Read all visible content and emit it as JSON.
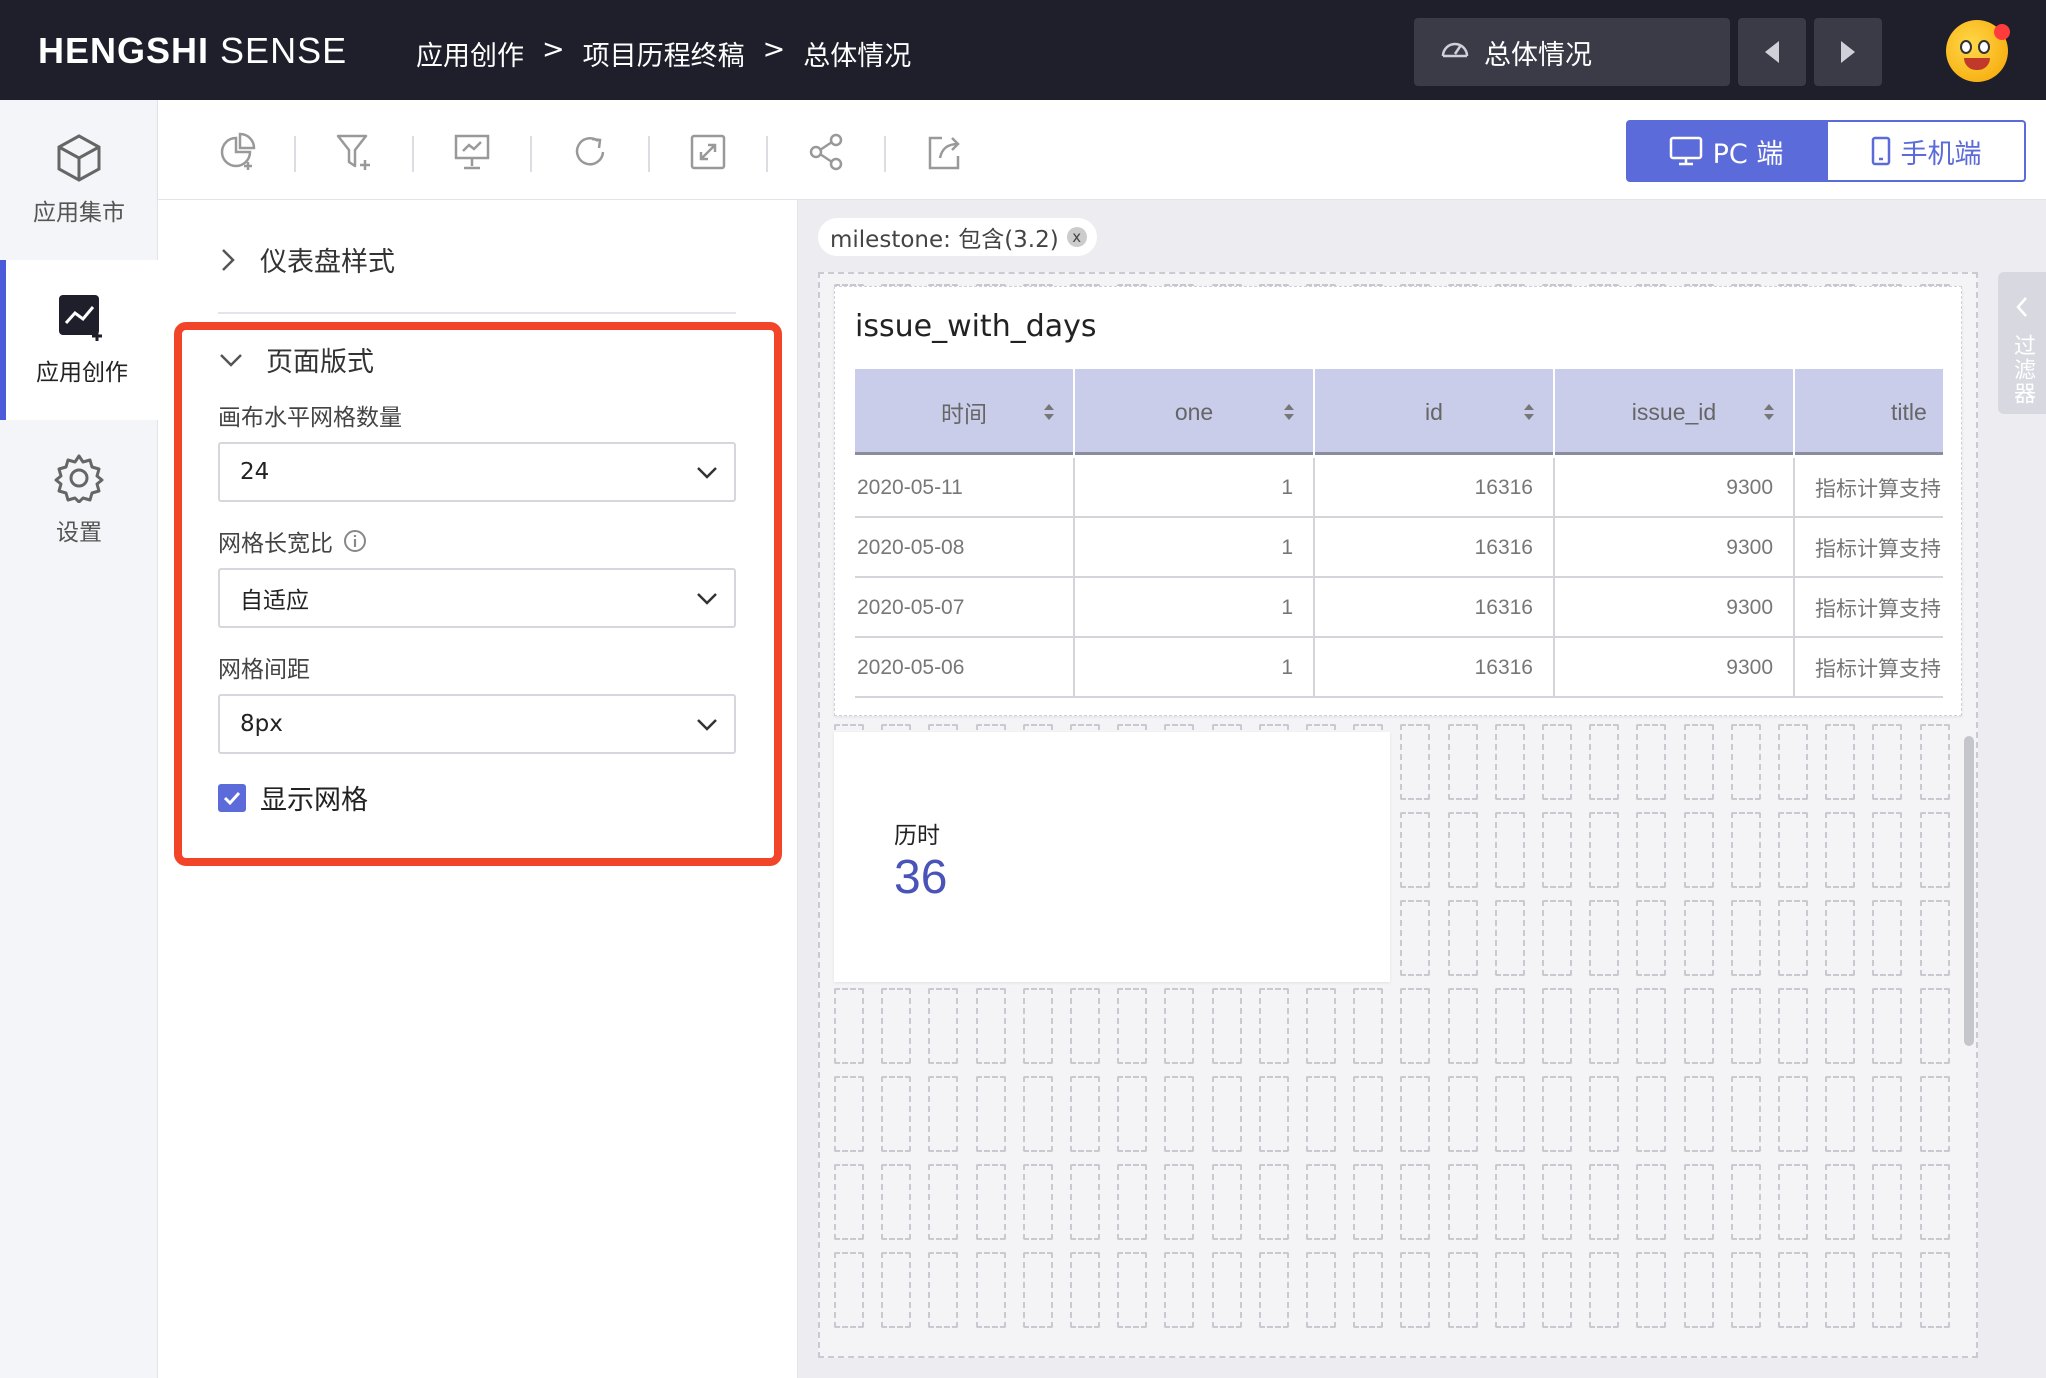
{
  "header": {
    "brand_bold": "HENGSHI",
    "brand_light": "SENSE",
    "breadcrumbs": [
      "应用创作",
      "项目历程终稿",
      "总体情况"
    ],
    "breadcrumb_sep": ">",
    "dashboard_select": "总体情况",
    "icons": [
      "dashboard-icon",
      "prev-arrow-icon",
      "next-arrow-icon"
    ]
  },
  "rail": {
    "items": [
      {
        "label": "应用集市",
        "icon": "cube-icon"
      },
      {
        "label": "应用创作",
        "icon": "chart-add-icon",
        "active": true
      },
      {
        "label": "设置",
        "icon": "gear-icon"
      }
    ]
  },
  "toolbar": {
    "tools": [
      "add-chart-icon",
      "add-filter-icon",
      "presentation-icon",
      "refresh-icon",
      "fullscreen-icon",
      "share-icon",
      "export-icon"
    ],
    "pc_label": "PC 端",
    "mobile_label": "手机端"
  },
  "panel": {
    "dashboard_style_label": "仪表盘样式",
    "page_layout_label": "页面版式",
    "grid_count_label": "画布水平网格数量",
    "grid_count_value": "24",
    "aspect_label": "网格长宽比",
    "aspect_value": "自适应",
    "gap_label": "网格间距",
    "gap_value": "8px",
    "show_grid_label": "显示网格",
    "show_grid_checked": true
  },
  "canvas": {
    "filter_chip": "milestone: 包含(3.2)",
    "filter_chip_close": "x",
    "side_filter_label": "过滤器",
    "table_card": {
      "title": "issue_with_days",
      "columns": [
        "时间",
        "one",
        "id",
        "issue_id",
        "title"
      ],
      "rows": [
        [
          "2020-05-11",
          "1",
          "16316",
          "9300",
          "指标计算支持"
        ],
        [
          "2020-05-08",
          "1",
          "16316",
          "9300",
          "指标计算支持"
        ],
        [
          "2020-05-07",
          "1",
          "16316",
          "9300",
          "指标计算支持"
        ],
        [
          "2020-05-06",
          "1",
          "16316",
          "9300",
          "指标计算支持"
        ]
      ]
    },
    "kpi_card": {
      "label": "历时",
      "value": "36"
    }
  },
  "colors": {
    "topbar": "#1e1f2a",
    "accent": "#5b6bd9",
    "highlight_box": "#f24428",
    "table_header": "#c9cdea",
    "kpi_value": "#4a54b8"
  }
}
